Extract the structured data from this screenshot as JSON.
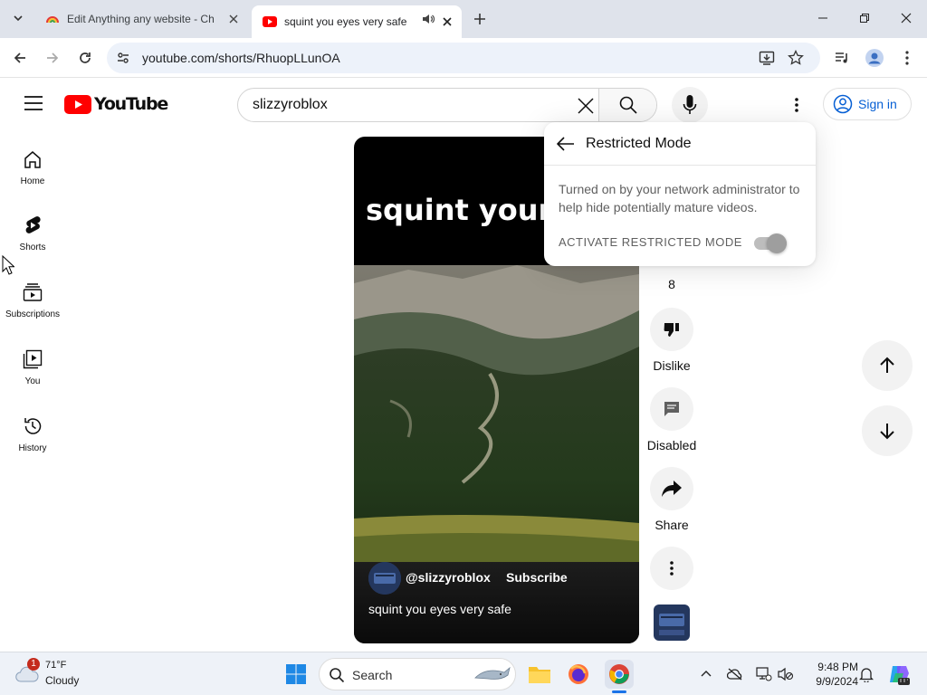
{
  "browser": {
    "tabs": [
      {
        "title": "Edit Anything any website - Ch"
      },
      {
        "title": "squint you eyes very safe - "
      }
    ],
    "url": "youtube.com/shorts/RhuopLLunOA"
  },
  "youtube": {
    "logo_text": "YouTube",
    "search_query": "slizzyroblox",
    "sign_in": "Sign in",
    "guide": [
      "Home",
      "Shorts",
      "Subscriptions",
      "You",
      "History"
    ],
    "video": {
      "overlay_text": "squint your e",
      "channel": "@slizzyroblox",
      "subscribe": "Subscribe",
      "title": "squint you eyes very safe"
    },
    "actions": {
      "like_count": "8",
      "dislike": "Dislike",
      "comments": "Disabled",
      "share": "Share"
    },
    "restricted": {
      "title": "Restricted Mode",
      "description": "Turned on by your network administrator to help hide potentially mature videos.",
      "activate_label": "ACTIVATE RESTRICTED MODE"
    }
  },
  "taskbar": {
    "weather_badge": "1",
    "temperature": "71°F",
    "condition": "Cloudy",
    "search": "Search",
    "time": "9:48 PM",
    "date": "9/9/2024"
  },
  "colors": {
    "youtube_red": "#ff0000",
    "link_blue": "#065fd4",
    "tab_strip": "#dfe3eb"
  }
}
